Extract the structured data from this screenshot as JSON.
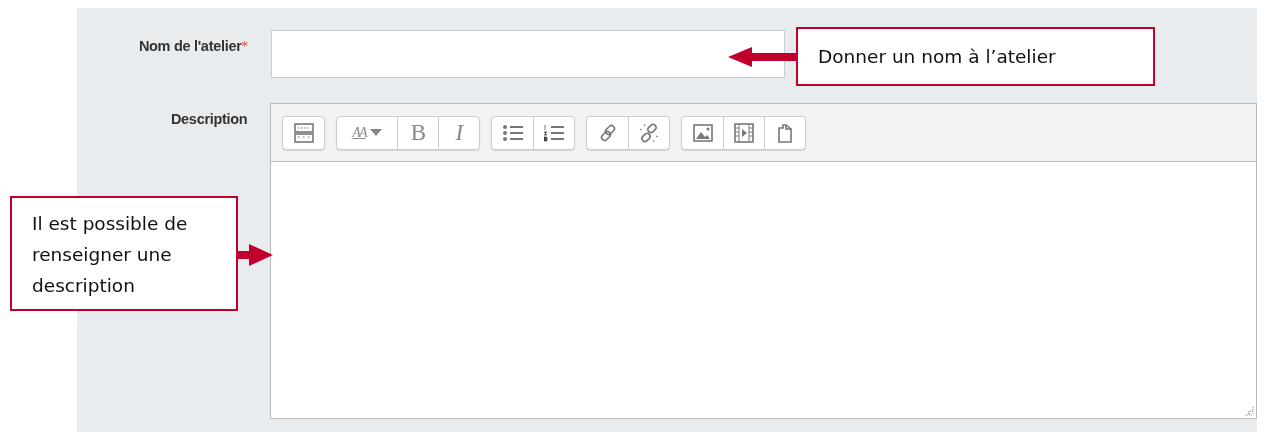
{
  "form": {
    "fields": [
      {
        "kind": "text",
        "label": "Nom de l'atelier",
        "required_mark": "*"
      },
      {
        "kind": "editor",
        "label": "Description",
        "toolbar": [
          [
            {
              "kind": "toggle"
            }
          ],
          [
            {
              "kind": "font-size",
              "label": "AA"
            },
            {
              "kind": "bold",
              "label": "B"
            },
            {
              "kind": "italic",
              "label": "I"
            }
          ],
          [
            {
              "kind": "bullets"
            },
            {
              "kind": "numbers"
            }
          ],
          [
            {
              "kind": "link"
            },
            {
              "kind": "unlink"
            }
          ],
          [
            {
              "kind": "image"
            },
            {
              "kind": "media"
            },
            {
              "kind": "file"
            }
          ]
        ]
      }
    ]
  },
  "callouts": [
    {
      "text": "Donner un nom à l’atelier"
    },
    {
      "text": "Il est possible de renseigner une description"
    }
  ]
}
